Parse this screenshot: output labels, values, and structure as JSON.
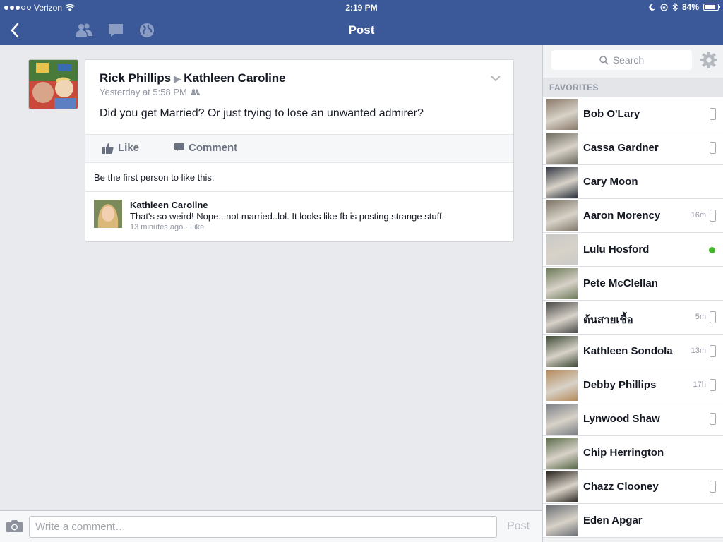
{
  "status_bar": {
    "carrier": "Verizon",
    "time": "2:19 PM",
    "battery": "84%",
    "battery_level": 0.84
  },
  "nav": {
    "title": "Post"
  },
  "post": {
    "author": "Rick Phillips",
    "recipient": "Kathleen Caroline",
    "timestamp": "Yesterday at 5:58 PM",
    "text": "Did you get Married?  Or just trying to lose an unwanted admirer?",
    "like_label": "Like",
    "comment_label": "Comment",
    "likes_text": "Be the first person to like this."
  },
  "comments": [
    {
      "author": "Kathleen Caroline",
      "text": "That's so weird! Nope...not married..lol. It looks like fb is posting strange stuff.",
      "time": "13 minutes ago",
      "like_label": "Like"
    }
  ],
  "composer": {
    "placeholder": "Write a comment…",
    "post_label": "Post"
  },
  "sidebar": {
    "search_placeholder": "Search",
    "favorites_label": "FAVORITES",
    "contacts": [
      {
        "name": "Bob O'Lary",
        "ago": "",
        "status": "mobile",
        "photo_color": "#8a7a6a"
      },
      {
        "name": "Cassa Gardner",
        "ago": "",
        "status": "mobile",
        "photo_color": "#6d6a5e"
      },
      {
        "name": "Cary Moon",
        "ago": "",
        "status": "none",
        "photo_color": "#2e3440"
      },
      {
        "name": "Aaron Morency",
        "ago": "16m",
        "status": "mobile",
        "photo_color": "#7f7668"
      },
      {
        "name": "Lulu Hosford",
        "ago": "",
        "status": "online",
        "photo_color": "#c9c9c9"
      },
      {
        "name": "Pete McClellan",
        "ago": "",
        "status": "none",
        "photo_color": "#6b7a58"
      },
      {
        "name": "ต้นสายเชื้อ",
        "ago": "5m",
        "status": "mobile",
        "photo_color": "#4a4a4a"
      },
      {
        "name": "Kathleen Sondola",
        "ago": "13m",
        "status": "mobile",
        "photo_color": "#3d4a35"
      },
      {
        "name": "Debby Phillips",
        "ago": "17h",
        "status": "mobile",
        "photo_color": "#b58a5a"
      },
      {
        "name": "Lynwood Shaw",
        "ago": "",
        "status": "mobile",
        "photo_color": "#7a7f86"
      },
      {
        "name": "Chip Herrington",
        "ago": "",
        "status": "none",
        "photo_color": "#5a6b4a"
      },
      {
        "name": "Chazz Clooney",
        "ago": "",
        "status": "mobile",
        "photo_color": "#2b2620"
      },
      {
        "name": "Eden Apgar",
        "ago": "",
        "status": "none",
        "photo_color": "#6a6e74"
      }
    ]
  },
  "colors": {
    "brand": "#3b5998",
    "online": "#42b72a"
  }
}
